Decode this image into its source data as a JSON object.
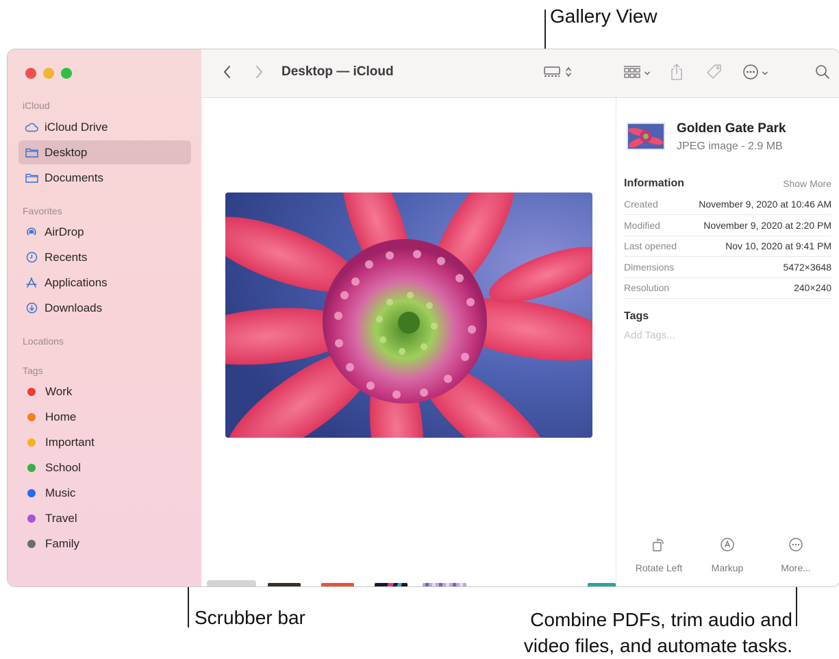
{
  "callouts": {
    "gallery": "Gallery View",
    "scrubber": "Scrubber bar",
    "more_line1": "Combine PDFs, trim audio and",
    "more_line2": "video files, and automate tasks."
  },
  "toolbar": {
    "title": "Desktop — iCloud",
    "icons": [
      "back-icon",
      "forward-icon",
      "gallery-view-icon",
      "group-icon",
      "share-icon",
      "tag-icon",
      "more-actions-icon",
      "search-icon"
    ]
  },
  "sidebar": {
    "sections": {
      "icloud": "iCloud",
      "favorites": "Favorites",
      "locations": "Locations",
      "tags": "Tags"
    },
    "icloud_items": [
      {
        "label": "iCloud Drive",
        "icon": "cloud-icon"
      },
      {
        "label": "Desktop",
        "icon": "folder-icon",
        "selected": true
      },
      {
        "label": "Documents",
        "icon": "folder-icon"
      }
    ],
    "favorite_items": [
      {
        "label": "AirDrop",
        "icon": "airdrop-icon"
      },
      {
        "label": "Recents",
        "icon": "clock-icon"
      },
      {
        "label": "Applications",
        "icon": "applications-icon"
      },
      {
        "label": "Downloads",
        "icon": "download-icon"
      }
    ],
    "tag_items": [
      {
        "label": "Work",
        "color": "#f23b36"
      },
      {
        "label": "Home",
        "color": "#f5801d"
      },
      {
        "label": "Important",
        "color": "#f6b318"
      },
      {
        "label": "School",
        "color": "#2fb24a"
      },
      {
        "label": "Music",
        "color": "#1f6ff2"
      },
      {
        "label": "Travel",
        "color": "#a853d9"
      },
      {
        "label": "Family",
        "color": "#6c6c70"
      }
    ]
  },
  "info": {
    "name": "Golden Gate Park",
    "kind_size": "JPEG image - 2.9 MB",
    "information_heading": "Information",
    "show_more": "Show More",
    "rows": [
      {
        "key": "Created",
        "value": "November 9, 2020 at 10:46 AM"
      },
      {
        "key": "Modified",
        "value": "November 9, 2020 at 2:20 PM"
      },
      {
        "key": "Last opened",
        "value": "Nov 10, 2020 at 9:41 PM"
      },
      {
        "key": "Dimensions",
        "value": "5472×3648"
      },
      {
        "key": "Resolution",
        "value": "240×240"
      }
    ],
    "tags_heading": "Tags",
    "add_tags_placeholder": "Add Tags...",
    "actions": [
      {
        "label": "Rotate Left",
        "icon": "rotate-left-icon"
      },
      {
        "label": "Markup",
        "icon": "markup-icon"
      },
      {
        "label": "More...",
        "icon": "more-icon"
      }
    ]
  },
  "colors": {
    "accent": "#2f6fd8",
    "sidebar_bg": "#f7d6da",
    "selected_row": "#dcb4b8"
  }
}
